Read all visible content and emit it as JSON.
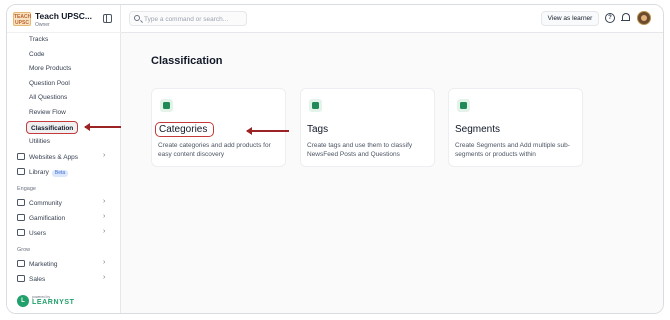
{
  "brand": {
    "name": "Teach UPSC...",
    "role": "Owner",
    "logo_text": "TEACH UPSC"
  },
  "sidebar": {
    "sub_items": [
      {
        "label": "Tracks"
      },
      {
        "label": "Code"
      },
      {
        "label": "More Products"
      },
      {
        "label": "Question Pool"
      },
      {
        "label": "All Questions"
      },
      {
        "label": "Review Flow"
      },
      {
        "label": "Classification"
      },
      {
        "label": "Utilities"
      }
    ],
    "websites": {
      "label": "Websites & Apps"
    },
    "library": {
      "label": "Library",
      "badge": "Beta"
    },
    "engage_label": "Engage",
    "engage_items": [
      {
        "label": "Community"
      },
      {
        "label": "Gamification"
      },
      {
        "label": "Users"
      }
    ],
    "grow_label": "Grow",
    "grow_items": [
      {
        "label": "Marketing"
      },
      {
        "label": "Sales"
      }
    ],
    "footer": {
      "small": "powered by",
      "brand": "LEARNYST",
      "badge": "L"
    }
  },
  "topbar": {
    "search_placeholder": "Type a command or search...",
    "view_as_learner": "View as learner",
    "help_glyph": "?"
  },
  "main": {
    "title": "Classification",
    "cards": [
      {
        "title": "Categories",
        "desc": "Create categories and add products for easy content discovery",
        "icon": "layers-icon"
      },
      {
        "title": "Tags",
        "desc": "Create tags and use them to classify NewsFeed Posts and Questions",
        "icon": "tag-icon"
      },
      {
        "title": "Segments",
        "desc": "Create Segments and Add multiple sub-segments or products within",
        "icon": "segments-icon"
      }
    ]
  },
  "colors": {
    "accent_green": "#1f8a55",
    "highlight_red": "#c43a3a",
    "arrow": "#9b2323"
  }
}
